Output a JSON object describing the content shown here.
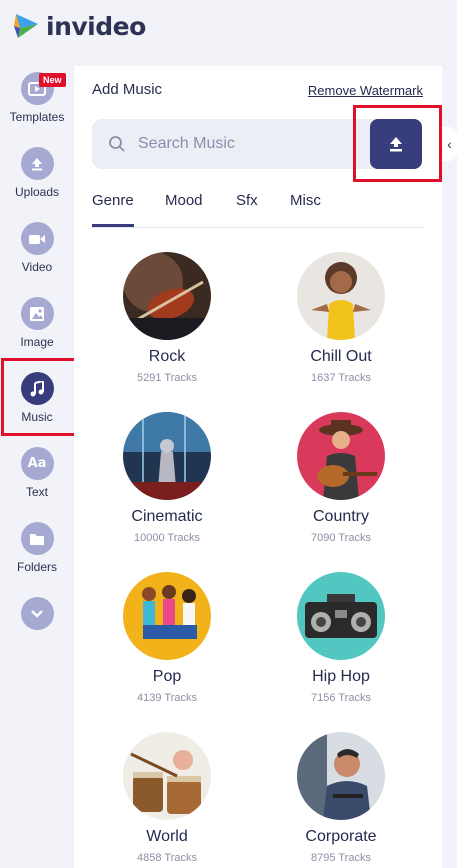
{
  "app": {
    "name": "invideo"
  },
  "rail": {
    "new_badge": "New",
    "items": [
      {
        "label": "Templates",
        "icon": "templates-icon"
      },
      {
        "label": "Uploads",
        "icon": "upload-icon"
      },
      {
        "label": "Video",
        "icon": "video-camera-icon"
      },
      {
        "label": "Image",
        "icon": "image-icon"
      },
      {
        "label": "Music",
        "icon": "music-note-icon",
        "active": true
      },
      {
        "label": "Text",
        "icon": "text-aa-icon"
      },
      {
        "label": "Folders",
        "icon": "folder-icon"
      }
    ],
    "more_icon": "chevron-down-icon"
  },
  "panel": {
    "title": "Add Music",
    "remove_watermark": "Remove Watermark",
    "search": {
      "placeholder": "Search Music"
    },
    "tabs": [
      "Genre",
      "Mood",
      "Sfx",
      "Misc"
    ],
    "active_tab": "Genre",
    "genres": [
      {
        "name": "Rock",
        "tracks": "5291 Tracks"
      },
      {
        "name": "Chill Out",
        "tracks": "1637 Tracks"
      },
      {
        "name": "Cinematic",
        "tracks": "10000 Tracks"
      },
      {
        "name": "Country",
        "tracks": "7090 Tracks"
      },
      {
        "name": "Pop",
        "tracks": "4139 Tracks"
      },
      {
        "name": "Hip Hop",
        "tracks": "7156 Tracks"
      },
      {
        "name": "World",
        "tracks": "4858 Tracks"
      },
      {
        "name": "Corporate",
        "tracks": "8795 Tracks"
      }
    ]
  },
  "colors": {
    "accent": "#383d7b",
    "rail_icon": "#a6aad2",
    "highlight_box": "#e0102a"
  }
}
